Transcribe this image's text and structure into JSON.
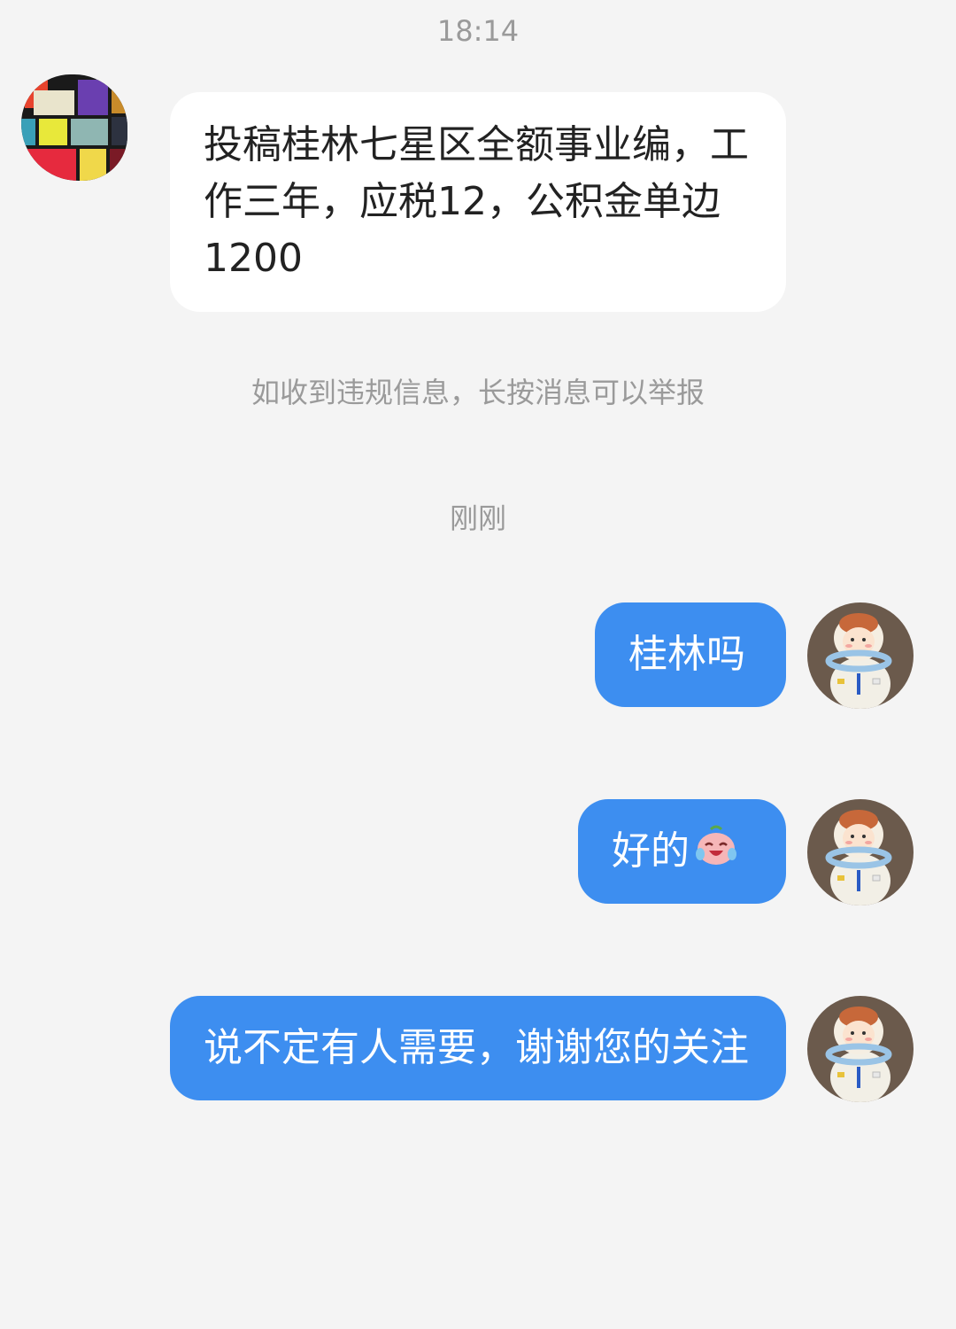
{
  "chat": {
    "time_top": "18:14",
    "notice": "如收到违规信息，长按消息可以举报",
    "time_recent": "刚刚",
    "messages": [
      {
        "side": "incoming",
        "text": "投稿桂林七星区全额事业编，工作三年，应税12，公积金单边1200"
      },
      {
        "side": "outgoing",
        "text": "桂林吗"
      },
      {
        "side": "outgoing",
        "text": "好的",
        "emoji": "crying-laughing-face-emoji"
      },
      {
        "side": "outgoing",
        "text": "说不定有人需要，谢谢您的关注"
      }
    ],
    "avatars": {
      "contact": "mosaic-tile-avatar",
      "self": "astronaut-figurine-avatar"
    }
  },
  "colors": {
    "background": "#f4f4f4",
    "incoming_bubble": "#ffffff",
    "outgoing_bubble": "#3d8ef0",
    "meta_text": "#9a9a9a"
  }
}
